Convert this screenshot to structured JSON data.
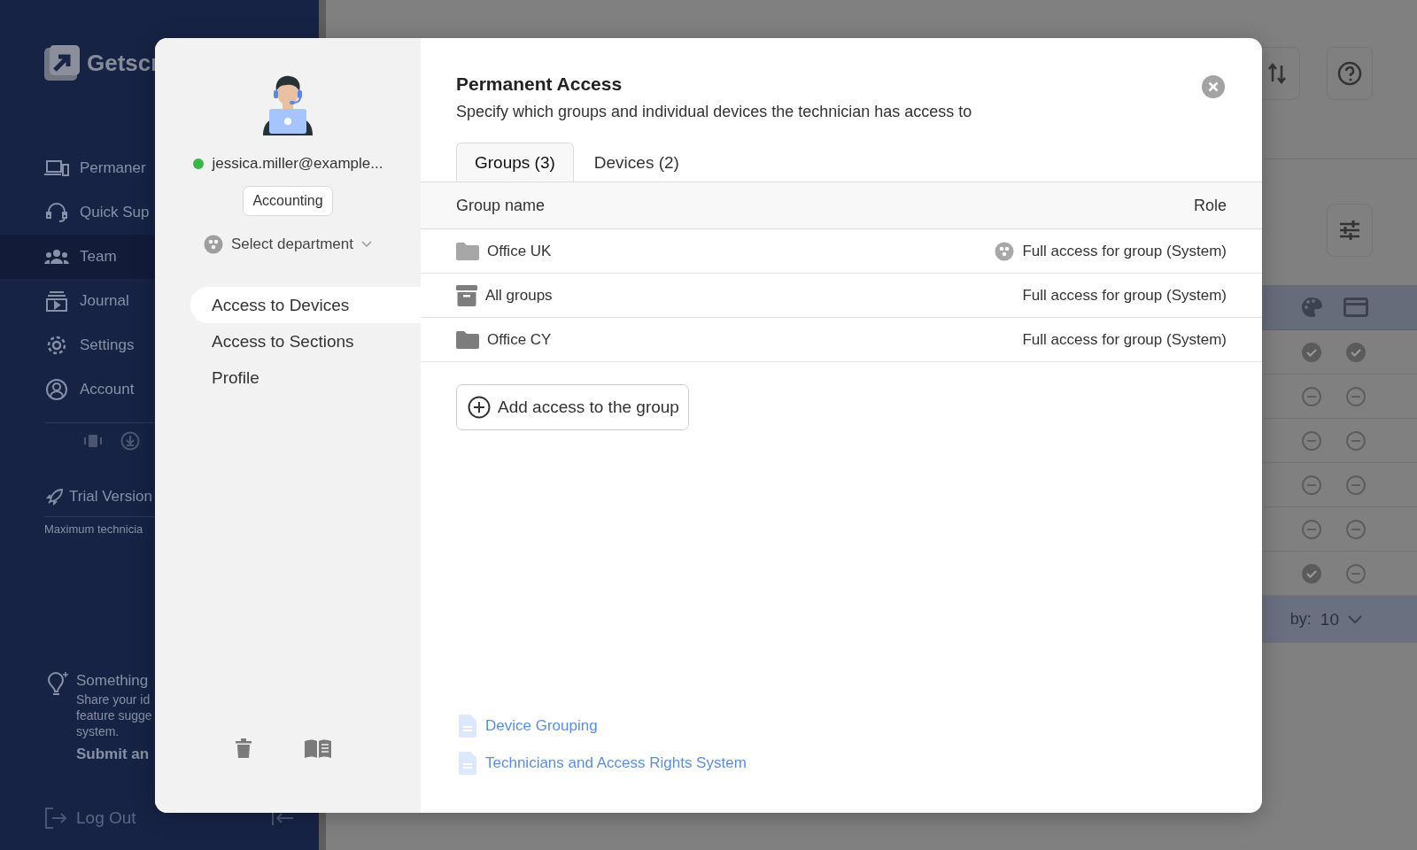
{
  "app": {
    "logo_text": "Getscr",
    "nav": [
      {
        "kind": "devices",
        "label": "Permaner",
        "selected": false
      },
      {
        "kind": "support",
        "label": "Quick Sup",
        "selected": false
      },
      {
        "kind": "team",
        "label": "Team",
        "selected": true
      },
      {
        "kind": "journal",
        "label": "Journal",
        "selected": false
      },
      {
        "kind": "settings",
        "label": "Settings",
        "selected": false
      },
      {
        "kind": "account",
        "label": "Account",
        "selected": false
      }
    ],
    "trial": {
      "title": "Trial Version",
      "note": "Maximum technicia"
    },
    "feedback": {
      "title": "Something",
      "lines": [
        "Share your id",
        "feature sugge",
        "system."
      ],
      "link": "Submit an"
    },
    "logout": "Log Out"
  },
  "background_table": {
    "rows": [
      [
        {
          "checked": true
        },
        {
          "checked": true
        }
      ],
      [
        {
          "checked": false
        },
        {
          "checked": false
        }
      ],
      [
        {
          "checked": false
        },
        {
          "checked": false
        }
      ],
      [
        {
          "checked": false
        },
        {
          "checked": false
        }
      ],
      [
        {
          "checked": false
        },
        {
          "checked": false
        }
      ],
      [
        {
          "checked": true
        },
        {
          "checked": false
        }
      ]
    ],
    "pagination": {
      "label": "by:",
      "value": "10"
    }
  },
  "dialog": {
    "user": {
      "email": "jessica.miller@example...",
      "online": true,
      "department_tag": "Accounting",
      "department_select": "Select department"
    },
    "menu": [
      {
        "label": "Access to Devices",
        "selected": true
      },
      {
        "label": "Access to Sections",
        "selected": false
      },
      {
        "label": "Profile",
        "selected": false
      }
    ],
    "title": "Permanent Access",
    "subtitle": "Specify which groups and individual devices the technician has access to",
    "tabs": [
      {
        "label": "Groups (3)",
        "selected": true
      },
      {
        "label": "Devices (2)",
        "selected": false
      }
    ],
    "columns": [
      "Group name",
      "Role"
    ],
    "rows": [
      {
        "kind": "folder",
        "color": "#a6a6a6",
        "name": "Office UK",
        "role": "Full access for group (System)",
        "role_icon": true
      },
      {
        "kind": "archive",
        "color": "#7d7d7d",
        "name": "All groups",
        "role": "Full access for group (System)",
        "role_icon": false
      },
      {
        "kind": "folder",
        "color": "#7d7d7d",
        "name": "Office CY",
        "role": "Full access for group (System)",
        "role_icon": false
      }
    ],
    "add_button": "Add access to the group",
    "links": [
      "Device Grouping",
      "Technicians and Access Rights System"
    ]
  }
}
